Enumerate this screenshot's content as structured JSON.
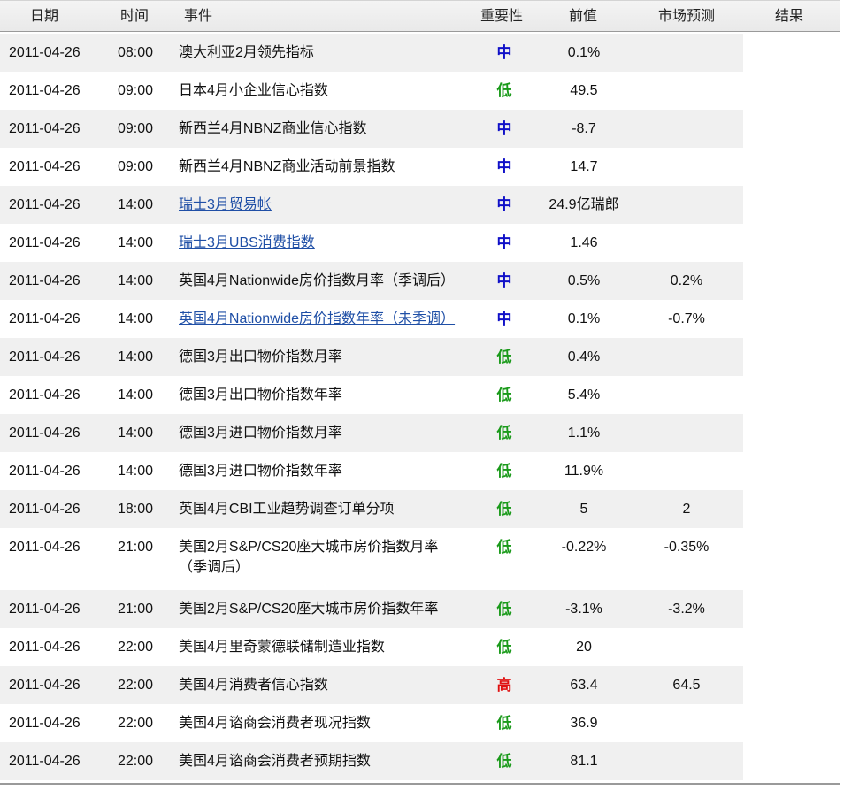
{
  "table": {
    "headers": {
      "date": "日期",
      "time": "时间",
      "event": "事件",
      "importance": "重要性",
      "previous": "前值",
      "forecast": "市场预测",
      "result": "结果"
    },
    "importance_colors": {
      "中": "#1010c8",
      "低": "#1a9a1a",
      "高": "#e01010"
    },
    "rows": [
      {
        "date": "2011-04-26",
        "time": "08:00",
        "event": "澳大利亚2月领先指标",
        "event_cont": "",
        "link": false,
        "importance": "中",
        "previous": "0.1%",
        "forecast": "",
        "result": ""
      },
      {
        "date": "2011-04-26",
        "time": "09:00",
        "event": "日本4月小企业信心指数",
        "event_cont": "",
        "link": false,
        "importance": "低",
        "previous": "49.5",
        "forecast": "",
        "result": ""
      },
      {
        "date": "2011-04-26",
        "time": "09:00",
        "event": "新西兰4月NBNZ商业信心指数",
        "event_cont": "",
        "link": false,
        "importance": "中",
        "previous": "-8.7",
        "forecast": "",
        "result": ""
      },
      {
        "date": "2011-04-26",
        "time": "09:00",
        "event": "新西兰4月NBNZ商业活动前景指数",
        "event_cont": "",
        "link": false,
        "importance": "中",
        "previous": "14.7",
        "forecast": "",
        "result": ""
      },
      {
        "date": "2011-04-26",
        "time": "14:00",
        "event": "瑞士3月贸易帐",
        "event_cont": "",
        "link": true,
        "importance": "中",
        "previous": "24.9亿瑞郎",
        "forecast": "",
        "result": ""
      },
      {
        "date": "2011-04-26",
        "time": "14:00",
        "event": "瑞士3月UBS消费指数",
        "event_cont": "",
        "link": true,
        "importance": "中",
        "previous": "1.46",
        "forecast": "",
        "result": ""
      },
      {
        "date": "2011-04-26",
        "time": "14:00",
        "event": "英国4月Nationwide房价指数月率（季调后）",
        "event_cont": "",
        "link": false,
        "importance": "中",
        "previous": "0.5%",
        "forecast": "0.2%",
        "result": ""
      },
      {
        "date": "2011-04-26",
        "time": "14:00",
        "event": "英国4月Nationwide房价指数年率（未季调）",
        "event_cont": "",
        "link": true,
        "importance": "中",
        "previous": "0.1%",
        "forecast": "-0.7%",
        "result": ""
      },
      {
        "date": "2011-04-26",
        "time": "14:00",
        "event": "德国3月出口物价指数月率",
        "event_cont": "",
        "link": false,
        "importance": "低",
        "previous": "0.4%",
        "forecast": "",
        "result": ""
      },
      {
        "date": "2011-04-26",
        "time": "14:00",
        "event": "德国3月出口物价指数年率",
        "event_cont": "",
        "link": false,
        "importance": "低",
        "previous": "5.4%",
        "forecast": "",
        "result": ""
      },
      {
        "date": "2011-04-26",
        "time": "14:00",
        "event": "德国3月进口物价指数月率",
        "event_cont": "",
        "link": false,
        "importance": "低",
        "previous": "1.1%",
        "forecast": "",
        "result": ""
      },
      {
        "date": "2011-04-26",
        "time": "14:00",
        "event": "德国3月进口物价指数年率",
        "event_cont": "",
        "link": false,
        "importance": "低",
        "previous": "11.9%",
        "forecast": "",
        "result": ""
      },
      {
        "date": "2011-04-26",
        "time": "18:00",
        "event": "英国4月CBI工业趋势调查订单分项",
        "event_cont": "",
        "link": false,
        "importance": "低",
        "previous": "5",
        "forecast": "2",
        "result": ""
      },
      {
        "date": "2011-04-26",
        "time": "21:00",
        "event": "美国2月S&P/CS20座大城市房价指数月率",
        "event_cont": "（季调后）",
        "link": false,
        "importance": "低",
        "previous": "-0.22%",
        "forecast": "-0.35%",
        "result": ""
      },
      {
        "date": "2011-04-26",
        "time": "21:00",
        "event": "美国2月S&P/CS20座大城市房价指数年率",
        "event_cont": "",
        "link": false,
        "importance": "低",
        "previous": "-3.1%",
        "forecast": "-3.2%",
        "result": ""
      },
      {
        "date": "2011-04-26",
        "time": "22:00",
        "event": "美国4月里奇蒙德联储制造业指数",
        "event_cont": "",
        "link": false,
        "importance": "低",
        "previous": "20",
        "forecast": "",
        "result": ""
      },
      {
        "date": "2011-04-26",
        "time": "22:00",
        "event": "美国4月消费者信心指数",
        "event_cont": "",
        "link": false,
        "importance": "高",
        "previous": "63.4",
        "forecast": "64.5",
        "result": ""
      },
      {
        "date": "2011-04-26",
        "time": "22:00",
        "event": "美国4月谘商会消费者现况指数",
        "event_cont": "",
        "link": false,
        "importance": "低",
        "previous": "36.9",
        "forecast": "",
        "result": ""
      },
      {
        "date": "2011-04-26",
        "time": "22:00",
        "event": "美国4月谘商会消费者预期指数",
        "event_cont": "",
        "link": false,
        "importance": "低",
        "previous": "81.1",
        "forecast": "",
        "result": ""
      }
    ]
  }
}
